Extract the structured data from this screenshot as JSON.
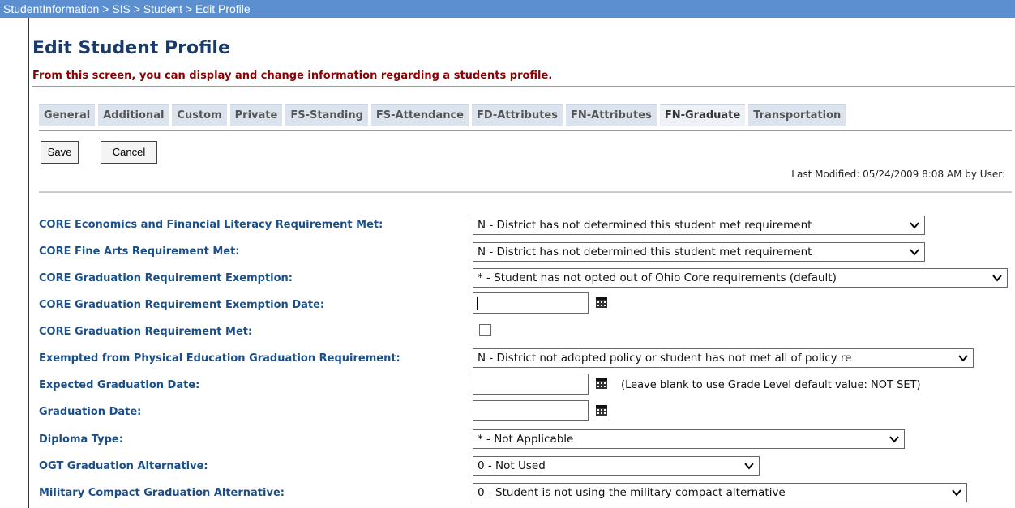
{
  "breadcrumb": "StudentInformation > SIS > Student > Edit Profile",
  "page": {
    "title": "Edit Student Profile",
    "subtitle": "From this screen, you can display and change information regarding a students profile."
  },
  "tabs": [
    {
      "label": "General"
    },
    {
      "label": "Additional"
    },
    {
      "label": "Custom"
    },
    {
      "label": "Private"
    },
    {
      "label": "FS-Standing"
    },
    {
      "label": "FS-Attendance"
    },
    {
      "label": "FD-Attributes"
    },
    {
      "label": "FN-Attributes"
    },
    {
      "label": "FN-Graduate",
      "active": true
    },
    {
      "label": "Transportation"
    }
  ],
  "toolbar": {
    "save_label": "Save",
    "cancel_label": "Cancel"
  },
  "last_modified": "Last Modified:  05/24/2009 8:08 AM  by User:",
  "fields": {
    "econ": {
      "label": "CORE Economics and Financial Literacy Requirement Met:",
      "value": "N - District has not determined this student met requirement"
    },
    "fine_arts": {
      "label": "CORE Fine Arts Requirement Met:",
      "value": "N - District has not determined this student met requirement"
    },
    "exemption": {
      "label": "CORE Graduation Requirement Exemption:",
      "value": "* - Student has not opted out of Ohio Core requirements (default)"
    },
    "exemption_date": {
      "label": "CORE Graduation Requirement Exemption Date:",
      "value": ""
    },
    "req_met": {
      "label": "CORE Graduation Requirement Met:",
      "checked": false
    },
    "pe_exempt": {
      "label": "Exempted from Physical Education Graduation Requirement:",
      "value": "N - District not adopted policy or student has not met all of policy re"
    },
    "expected_grad": {
      "label": "Expected Graduation Date:",
      "value": "",
      "hint": "(Leave blank to use Grade Level default value: NOT SET)"
    },
    "grad_date": {
      "label": "Graduation Date:",
      "value": ""
    },
    "diploma": {
      "label": "Diploma Type:",
      "value": "* - Not Applicable"
    },
    "ogt": {
      "label": "OGT Graduation Alternative:",
      "value": "0 - Not Used"
    },
    "military": {
      "label": "Military Compact Graduation Alternative:",
      "value": "0 - Student is not using the military compact alternative"
    }
  },
  "icons": {
    "dropdown": "chevron-down-icon",
    "calendar": "calendar-icon"
  }
}
